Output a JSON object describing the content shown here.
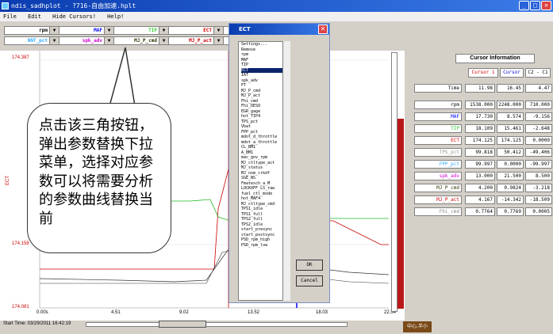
{
  "window": {
    "title": "ndis_sadhplot - ?716-自由加速.hplt"
  },
  "menu": [
    "File",
    "Edit",
    "Hide Cursors!",
    "Help!"
  ],
  "selectors_row1": [
    {
      "label": "rpm",
      "color": "#000000"
    },
    {
      "label": "MAF",
      "color": "#0000ff"
    },
    {
      "label": "TIP",
      "color": "#33cc33"
    },
    {
      "label": "ECT",
      "color": "#e00000"
    },
    {
      "label": "...",
      "color": "#000000"
    }
  ],
  "selectors_row2": [
    {
      "label": "NNT_pct",
      "color": "#33aaff"
    },
    {
      "label": "spk_adv",
      "color": "#cc00cc"
    },
    {
      "label": "MJ_P_cmd",
      "color": "#333300"
    },
    {
      "label": "MJ_P_act",
      "color": "#cc0000"
    },
    {
      "label": "...",
      "color": "#000000"
    }
  ],
  "plot": {
    "y_ticks": [
      "174.387",
      "174.158",
      "174.081"
    ],
    "y_axis_label": "ECT",
    "x_ticks": [
      "0.00s",
      "4.51",
      "9.02",
      "13.52",
      "18.03",
      "22.54"
    ],
    "start_time": "Start Time: 03/29/2011 16:42:19"
  },
  "dialog": {
    "title": "ECT",
    "items": [
      "Settings...",
      "Remove",
      "rpm",
      "MAF",
      "TIP",
      "ECT",
      "IAT",
      "spk_adv",
      "FT",
      "MJ_P_cmd",
      "MJ_P_act",
      "Fhi_cmd",
      "Fhi_DESO",
      "EGR_gage",
      "hot_TIP4",
      "TPS_pct",
      "Vbat",
      "FPP_pct",
      "mdot_d_throttle",
      "mdot_a_throttle",
      "CL_BM1",
      "A_BM1",
      "mac_gov_rpm",
      "MJ_ctltype_act",
      "MJ_status",
      "MJ_nom_crkdf",
      "SGE_NS",
      "Fmatesch_a_M",
      "LOCKOFF_LS_raw",
      "fuel_ctl_mode",
      "hot_MAF4",
      "MJ_ctltype_cmd",
      "TPS1_idle",
      "TPS1_full",
      "TPS2_full",
      "TPS2_idle",
      "start_presync",
      "start_postsync",
      "PSD_rpm_high",
      "PSD_rpm_low"
    ],
    "selected": "ECT",
    "ok_label": "OK",
    "cancel_label": "Cancel"
  },
  "callout": {
    "text": "点击该三角按钮，弹出参数替换下拉菜单，选择对应参数可以将需要分析的参数曲线替换当前"
  },
  "cursor_info": {
    "title": "Cursor Information",
    "headers": [
      "Cursor 1",
      "Cursor",
      "C2 - C1"
    ],
    "rows": [
      {
        "label": "Time",
        "color": "#000000",
        "c1": "11.98",
        "c2": "16.45",
        "diff": "4.47"
      },
      {
        "label": "rpm",
        "color": "#000000",
        "c1": "1538.000",
        "c2": "2248.000",
        "diff": "710.000"
      },
      {
        "label": "MAF",
        "color": "#0000ff",
        "c1": "17.730",
        "c2": "8.574",
        "diff": "-9.156"
      },
      {
        "label": "TIP",
        "color": "#33cc33",
        "c1": "18.109",
        "c2": "15.461",
        "diff": "-2.648"
      },
      {
        "label": "ECT",
        "color": "#e00000",
        "c1": "174.125",
        "c2": "174.125",
        "diff": "0.0000"
      },
      {
        "label": "TPS_pct",
        "color": "#999999",
        "c1": "99.818",
        "c2": "50.412",
        "diff": "-49.406"
      },
      {
        "label": "FPP_pct",
        "color": "#33aaff",
        "c1": "99.997",
        "c2": "0.0000",
        "diff": "-99.997"
      },
      {
        "label": "spk_adv",
        "color": "#cc00cc",
        "c1": "13.000",
        "c2": "21.500",
        "diff": "8.500"
      },
      {
        "label": "MJ_P_cmd",
        "color": "#333300",
        "c1": "4.200",
        "c2": "0.9824",
        "diff": "-3.218"
      },
      {
        "label": "MJ_P_act",
        "color": "#cc0000",
        "c1": "4.167",
        "c2": "-14.342",
        "diff": "-18.509"
      },
      {
        "label": "Fhi_cmd",
        "color": "#888888",
        "c1": "0.7764",
        "c2": "0.7769",
        "diff": "0.0005"
      }
    ]
  },
  "bottom_button": "中心,半小"
}
